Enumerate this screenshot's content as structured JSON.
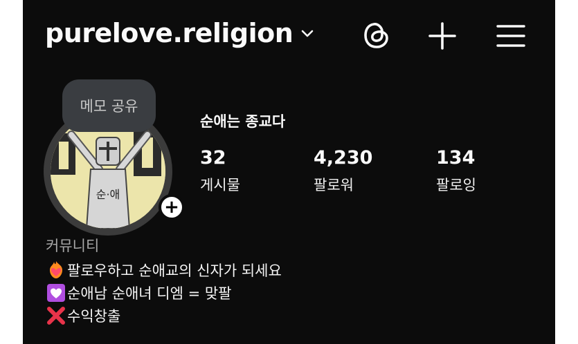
{
  "header": {
    "username": "purelove.religion",
    "icons": [
      "chevron-down-icon",
      "threads-icon",
      "plus-icon",
      "menu-icon"
    ]
  },
  "profile": {
    "memo_bubble": "메모 공유",
    "display_name": "순애는 종교다",
    "stats": [
      {
        "value": "32",
        "label": "게시물"
      },
      {
        "value": "4,230",
        "label": "팔로워"
      },
      {
        "value": "134",
        "label": "팔로잉"
      }
    ],
    "avatar_caption": "순·애"
  },
  "bio": {
    "category": "커뮤니티",
    "lines": [
      {
        "emoji": "heart-on-fire",
        "text": "팔로우하고 순애교의 신자가 되세요"
      },
      {
        "emoji": "heart-decoration",
        "text": "순애남 순애녀 디엠 = 맞팔"
      },
      {
        "emoji": "cross-mark",
        "text": "수익창출"
      }
    ]
  },
  "colors": {
    "background": "#0c0c0c",
    "text": "#f5f5f5",
    "muted": "#a8a8a8",
    "memo_bubble": "#3a3d41"
  }
}
